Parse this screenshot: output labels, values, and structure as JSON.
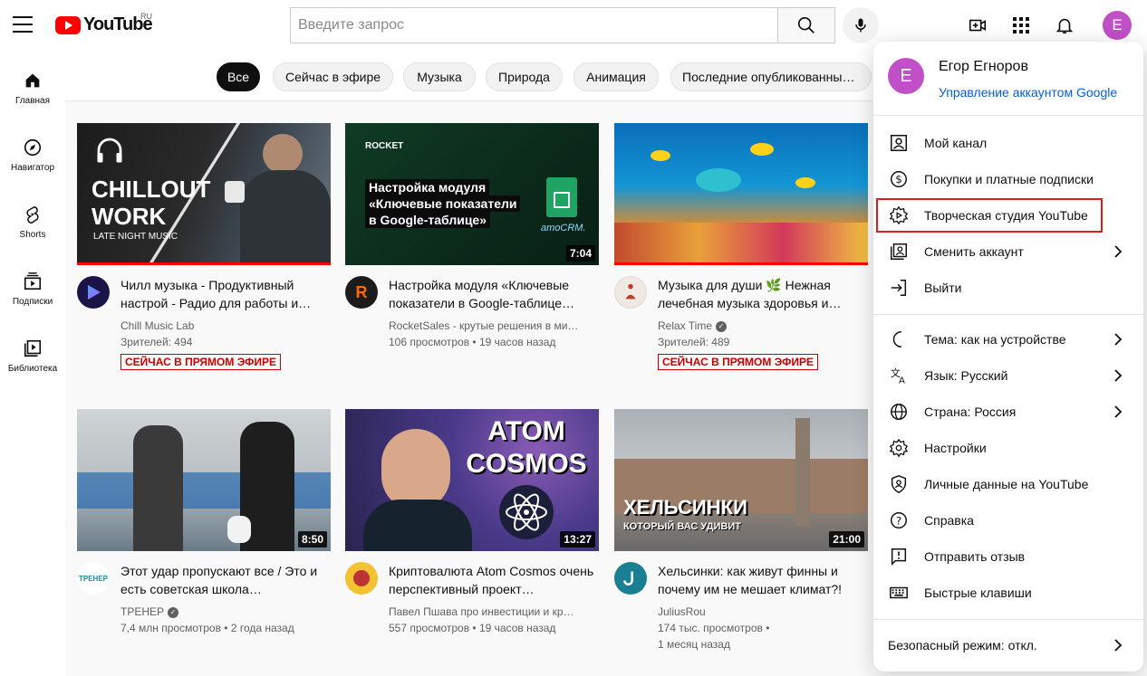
{
  "header": {
    "logo_text": "YouTube",
    "logo_region": "RU",
    "search_placeholder": "Введите запрос",
    "avatar_letter": "E",
    "accent_red": "#ff0000",
    "avatar_color": "#c04fc8"
  },
  "sidebar": {
    "items": [
      {
        "label": "Главная",
        "icon": "home-icon"
      },
      {
        "label": "Навигатор",
        "icon": "compass-icon"
      },
      {
        "label": "Shorts",
        "icon": "shorts-icon"
      },
      {
        "label": "Подписки",
        "icon": "subscriptions-icon"
      },
      {
        "label": "Библиотека",
        "icon": "library-icon"
      }
    ]
  },
  "chips": [
    "Все",
    "Сейчас в эфире",
    "Музыка",
    "Природа",
    "Анимация",
    "Последние опубликованны…"
  ],
  "videos": [
    {
      "thumb_text_1": "CHILLOUT",
      "thumb_text_2": "WORK",
      "thumb_text_3": "LATE NIGHT MUSIC",
      "title": "Чилл музыка - Продуктивный настрой - Радио для работы и…",
      "channel": "Chill Music Lab",
      "stats": "Зрителей: 494",
      "live": "СЕЙЧАС В ПРЯМОМ ЭФИРЕ"
    },
    {
      "thumb_brand": "ROCKET",
      "thumb_text_1": "Настройка модуля",
      "thumb_text_2": "«Ключевые показатели",
      "thumb_text_3": "в Google-таблице»",
      "thumb_logo": "amoCRM.",
      "duration": "7:04",
      "title": "Настройка модуля «Ключевые показатели в Google-таблице…",
      "channel": "RocketSales - крутые решения в ми…",
      "stats": "106 просмотров • 19 часов назад"
    },
    {
      "title": "Музыка для души 🌿 Нежная лечебная музыка здоровья и…",
      "channel": "Relax Time",
      "stats": "Зрителей: 489",
      "live": "СЕЙЧАС В ПРЯМОМ ЭФИРЕ"
    },
    {
      "duration": "8:50",
      "channel_avatar_text": "ТРЕНЕР",
      "title": "Этот удар пропускают все / Это и есть советская школа…",
      "channel": "ТРЕНЕР",
      "stats": "7,4 млн просмотров • 2 года назад"
    },
    {
      "thumb_text_1": "ATOM",
      "thumb_text_2": "COSMOS",
      "duration": "13:27",
      "title": "Криптовалюта Atom Cosmos очень перспективный проект…",
      "channel": "Павел Пшава про инвестиции и кр…",
      "stats": "557 просмотров • 19 часов назад"
    },
    {
      "thumb_text_1": "ХЕЛЬСИНКИ",
      "thumb_text_2": "КОТОРЫЙ ВАС УДИВИТ",
      "duration": "21:00",
      "title": "Хельсинки: как живут финны и почему им не мешает климат?!",
      "channel": "JuliusRou",
      "stats": "174 тыс. просмотров •",
      "stats2": "1 месяц назад"
    }
  ],
  "account_menu": {
    "avatar_letter": "E",
    "name": "Егор Егноров",
    "manage": "Управление аккаунтом Google",
    "section1": [
      {
        "label": "Мой канал",
        "icon": "account-icon"
      },
      {
        "label": "Покупки и платные подписки",
        "icon": "dollar-icon"
      },
      {
        "label": "Творческая студия YouTube",
        "icon": "studio-gear-icon"
      },
      {
        "label": "Сменить аккаунт",
        "icon": "switch-account-icon",
        "arrow": true
      },
      {
        "label": "Выйти",
        "icon": "sign-out-icon"
      }
    ],
    "section2": [
      {
        "label": "Тема: как на устройстве",
        "icon": "moon-icon",
        "arrow": true
      },
      {
        "label": "Язык: Русский",
        "icon": "translate-icon",
        "arrow": true
      },
      {
        "label": "Страна: Россия",
        "icon": "globe-icon",
        "arrow": true
      },
      {
        "label": "Настройки",
        "icon": "settings-icon"
      },
      {
        "label": "Личные данные на YouTube",
        "icon": "shield-icon"
      },
      {
        "label": "Справка",
        "icon": "help-icon"
      },
      {
        "label": "Отправить отзыв",
        "icon": "feedback-icon"
      },
      {
        "label": "Быстрые клавиши",
        "icon": "keyboard-icon"
      }
    ],
    "safe_mode": "Безопасный режим: откл.",
    "highlight_color": "#d91e1e"
  }
}
